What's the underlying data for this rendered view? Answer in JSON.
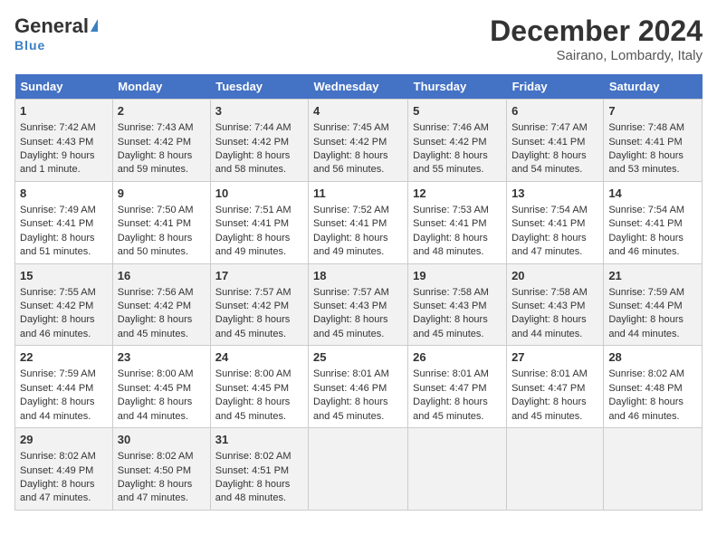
{
  "header": {
    "logo_general": "General",
    "logo_blue": "Blue",
    "month_title": "December 2024",
    "location": "Sairano, Lombardy, Italy"
  },
  "days_of_week": [
    "Sunday",
    "Monday",
    "Tuesday",
    "Wednesday",
    "Thursday",
    "Friday",
    "Saturday"
  ],
  "weeks": [
    [
      {
        "day": "1",
        "line1": "Sunrise: 7:42 AM",
        "line2": "Sunset: 4:43 PM",
        "line3": "Daylight: 9 hours",
        "line4": "and 1 minute."
      },
      {
        "day": "2",
        "line1": "Sunrise: 7:43 AM",
        "line2": "Sunset: 4:42 PM",
        "line3": "Daylight: 8 hours",
        "line4": "and 59 minutes."
      },
      {
        "day": "3",
        "line1": "Sunrise: 7:44 AM",
        "line2": "Sunset: 4:42 PM",
        "line3": "Daylight: 8 hours",
        "line4": "and 58 minutes."
      },
      {
        "day": "4",
        "line1": "Sunrise: 7:45 AM",
        "line2": "Sunset: 4:42 PM",
        "line3": "Daylight: 8 hours",
        "line4": "and 56 minutes."
      },
      {
        "day": "5",
        "line1": "Sunrise: 7:46 AM",
        "line2": "Sunset: 4:42 PM",
        "line3": "Daylight: 8 hours",
        "line4": "and 55 minutes."
      },
      {
        "day": "6",
        "line1": "Sunrise: 7:47 AM",
        "line2": "Sunset: 4:41 PM",
        "line3": "Daylight: 8 hours",
        "line4": "and 54 minutes."
      },
      {
        "day": "7",
        "line1": "Sunrise: 7:48 AM",
        "line2": "Sunset: 4:41 PM",
        "line3": "Daylight: 8 hours",
        "line4": "and 53 minutes."
      }
    ],
    [
      {
        "day": "8",
        "line1": "Sunrise: 7:49 AM",
        "line2": "Sunset: 4:41 PM",
        "line3": "Daylight: 8 hours",
        "line4": "and 51 minutes."
      },
      {
        "day": "9",
        "line1": "Sunrise: 7:50 AM",
        "line2": "Sunset: 4:41 PM",
        "line3": "Daylight: 8 hours",
        "line4": "and 50 minutes."
      },
      {
        "day": "10",
        "line1": "Sunrise: 7:51 AM",
        "line2": "Sunset: 4:41 PM",
        "line3": "Daylight: 8 hours",
        "line4": "and 49 minutes."
      },
      {
        "day": "11",
        "line1": "Sunrise: 7:52 AM",
        "line2": "Sunset: 4:41 PM",
        "line3": "Daylight: 8 hours",
        "line4": "and 49 minutes."
      },
      {
        "day": "12",
        "line1": "Sunrise: 7:53 AM",
        "line2": "Sunset: 4:41 PM",
        "line3": "Daylight: 8 hours",
        "line4": "and 48 minutes."
      },
      {
        "day": "13",
        "line1": "Sunrise: 7:54 AM",
        "line2": "Sunset: 4:41 PM",
        "line3": "Daylight: 8 hours",
        "line4": "and 47 minutes."
      },
      {
        "day": "14",
        "line1": "Sunrise: 7:54 AM",
        "line2": "Sunset: 4:41 PM",
        "line3": "Daylight: 8 hours",
        "line4": "and 46 minutes."
      }
    ],
    [
      {
        "day": "15",
        "line1": "Sunrise: 7:55 AM",
        "line2": "Sunset: 4:42 PM",
        "line3": "Daylight: 8 hours",
        "line4": "and 46 minutes."
      },
      {
        "day": "16",
        "line1": "Sunrise: 7:56 AM",
        "line2": "Sunset: 4:42 PM",
        "line3": "Daylight: 8 hours",
        "line4": "and 45 minutes."
      },
      {
        "day": "17",
        "line1": "Sunrise: 7:57 AM",
        "line2": "Sunset: 4:42 PM",
        "line3": "Daylight: 8 hours",
        "line4": "and 45 minutes."
      },
      {
        "day": "18",
        "line1": "Sunrise: 7:57 AM",
        "line2": "Sunset: 4:43 PM",
        "line3": "Daylight: 8 hours",
        "line4": "and 45 minutes."
      },
      {
        "day": "19",
        "line1": "Sunrise: 7:58 AM",
        "line2": "Sunset: 4:43 PM",
        "line3": "Daylight: 8 hours",
        "line4": "and 45 minutes."
      },
      {
        "day": "20",
        "line1": "Sunrise: 7:58 AM",
        "line2": "Sunset: 4:43 PM",
        "line3": "Daylight: 8 hours",
        "line4": "and 44 minutes."
      },
      {
        "day": "21",
        "line1": "Sunrise: 7:59 AM",
        "line2": "Sunset: 4:44 PM",
        "line3": "Daylight: 8 hours",
        "line4": "and 44 minutes."
      }
    ],
    [
      {
        "day": "22",
        "line1": "Sunrise: 7:59 AM",
        "line2": "Sunset: 4:44 PM",
        "line3": "Daylight: 8 hours",
        "line4": "and 44 minutes."
      },
      {
        "day": "23",
        "line1": "Sunrise: 8:00 AM",
        "line2": "Sunset: 4:45 PM",
        "line3": "Daylight: 8 hours",
        "line4": "and 44 minutes."
      },
      {
        "day": "24",
        "line1": "Sunrise: 8:00 AM",
        "line2": "Sunset: 4:45 PM",
        "line3": "Daylight: 8 hours",
        "line4": "and 45 minutes."
      },
      {
        "day": "25",
        "line1": "Sunrise: 8:01 AM",
        "line2": "Sunset: 4:46 PM",
        "line3": "Daylight: 8 hours",
        "line4": "and 45 minutes."
      },
      {
        "day": "26",
        "line1": "Sunrise: 8:01 AM",
        "line2": "Sunset: 4:47 PM",
        "line3": "Daylight: 8 hours",
        "line4": "and 45 minutes."
      },
      {
        "day": "27",
        "line1": "Sunrise: 8:01 AM",
        "line2": "Sunset: 4:47 PM",
        "line3": "Daylight: 8 hours",
        "line4": "and 45 minutes."
      },
      {
        "day": "28",
        "line1": "Sunrise: 8:02 AM",
        "line2": "Sunset: 4:48 PM",
        "line3": "Daylight: 8 hours",
        "line4": "and 46 minutes."
      }
    ],
    [
      {
        "day": "29",
        "line1": "Sunrise: 8:02 AM",
        "line2": "Sunset: 4:49 PM",
        "line3": "Daylight: 8 hours",
        "line4": "and 47 minutes."
      },
      {
        "day": "30",
        "line1": "Sunrise: 8:02 AM",
        "line2": "Sunset: 4:50 PM",
        "line3": "Daylight: 8 hours",
        "line4": "and 47 minutes."
      },
      {
        "day": "31",
        "line1": "Sunrise: 8:02 AM",
        "line2": "Sunset: 4:51 PM",
        "line3": "Daylight: 8 hours",
        "line4": "and 48 minutes."
      },
      null,
      null,
      null,
      null
    ]
  ]
}
